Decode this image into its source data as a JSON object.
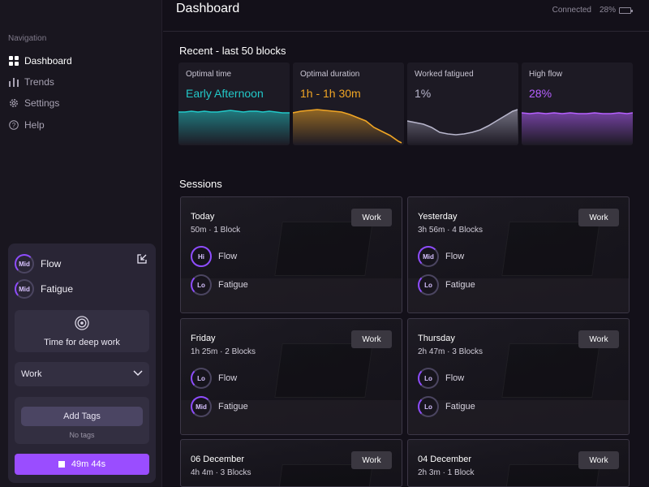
{
  "header": {
    "title": "Dashboard",
    "connection": "Connected",
    "battery": "28%"
  },
  "sidebar": {
    "title": "Navigation",
    "items": [
      {
        "label": "Dashboard",
        "icon": "grid-icon"
      },
      {
        "label": "Trends",
        "icon": "bar-chart-icon"
      },
      {
        "label": "Settings",
        "icon": "gear-icon"
      },
      {
        "label": "Help",
        "icon": "help-icon"
      }
    ]
  },
  "focus_panel": {
    "flow": {
      "level": "Mid",
      "label": "Flow"
    },
    "fatigue": {
      "level": "Mid",
      "label": "Fatigue"
    },
    "deep_work_label": "Time for deep work",
    "activity_select": "Work",
    "add_tags_label": "Add Tags",
    "no_tags_label": "No tags",
    "timer": "49m 44s"
  },
  "recent": {
    "title": "Recent - last 50 blocks",
    "cards": [
      {
        "label": "Optimal time",
        "value": "Early Afternoon",
        "color": "#22c8c8"
      },
      {
        "label": "Optimal duration",
        "value": "1h - 1h 30m",
        "color": "#f0a524"
      },
      {
        "label": "Worked fatigued",
        "value": "1%",
        "color": "#b8b6cc"
      },
      {
        "label": "High flow",
        "value": "28%",
        "color": "#b660ff"
      }
    ]
  },
  "sessions": {
    "title": "Sessions",
    "items": [
      {
        "day": "Today",
        "meta": "50m · 1 Block",
        "tag": "Work",
        "flow": "Hi",
        "flow_label": "Flow",
        "fatigue": "Lo",
        "fatigue_label": "Fatigue"
      },
      {
        "day": "Yesterday",
        "meta": "3h 56m · 4 Blocks",
        "tag": "Work",
        "flow": "Mid",
        "flow_label": "Flow",
        "fatigue": "Lo",
        "fatigue_label": "Fatigue"
      },
      {
        "day": "Friday",
        "meta": "1h 25m · 2 Blocks",
        "tag": "Work",
        "flow": "Lo",
        "flow_label": "Flow",
        "fatigue": "Mid",
        "fatigue_label": "Fatigue"
      },
      {
        "day": "Thursday",
        "meta": "2h 47m · 3 Blocks",
        "tag": "Work",
        "flow": "Lo",
        "flow_label": "Flow",
        "fatigue": "Lo",
        "fatigue_label": "Fatigue"
      },
      {
        "day": "06 December",
        "meta": "4h 4m · 3 Blocks",
        "tag": "Work"
      },
      {
        "day": "04 December",
        "meta": "2h 3m · 1 Block",
        "tag": "Work"
      }
    ]
  }
}
